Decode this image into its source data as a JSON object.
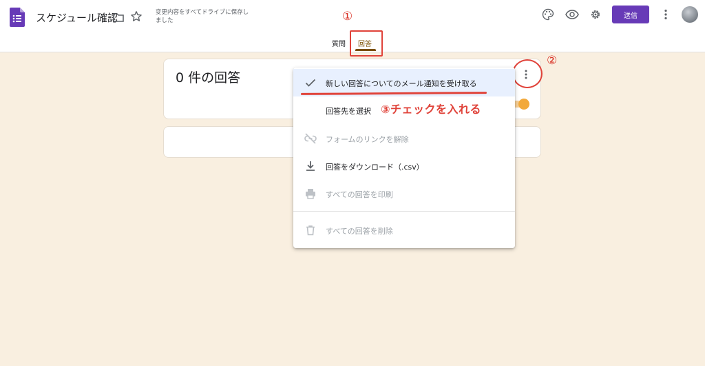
{
  "header": {
    "title": "スケジュール確認",
    "saved_status": "変更内容をすべてドライブに保存しました",
    "send_label": "送信",
    "icons": [
      "forms-logo-icon",
      "folder-icon",
      "star-icon",
      "palette-icon",
      "eye-icon",
      "gear-icon",
      "more-vert-icon",
      "avatar"
    ]
  },
  "tabs": [
    {
      "label": "質問",
      "active": false
    },
    {
      "label": "回答",
      "active": true
    }
  ],
  "main": {
    "response_count": "0 件の回答"
  },
  "menu": {
    "items": [
      {
        "label": "新しい回答についてのメール通知を受け取る",
        "icon": "check-icon",
        "enabled": true,
        "highlighted": true
      },
      {
        "label": "回答先を選択",
        "icon": "",
        "enabled": true
      },
      {
        "label": "フォームのリンクを解除",
        "icon": "link-off-icon",
        "enabled": false
      },
      {
        "label": "回答をダウンロード（.csv）",
        "icon": "download-icon",
        "enabled": true
      },
      {
        "label": "すべての回答を印刷",
        "icon": "print-icon",
        "enabled": false
      },
      {
        "label": "すべての回答を削除",
        "icon": "trash-icon",
        "enabled": false
      }
    ]
  },
  "annotations": {
    "step1": "①",
    "step2": "②",
    "step3": "③チェックを入れる"
  },
  "colors": {
    "accent_purple": "#673ab7",
    "annotation_red": "#e0433a",
    "active_tab": "#7a4f01",
    "background": "#f9efe0",
    "toggle": "#f2a93b"
  }
}
